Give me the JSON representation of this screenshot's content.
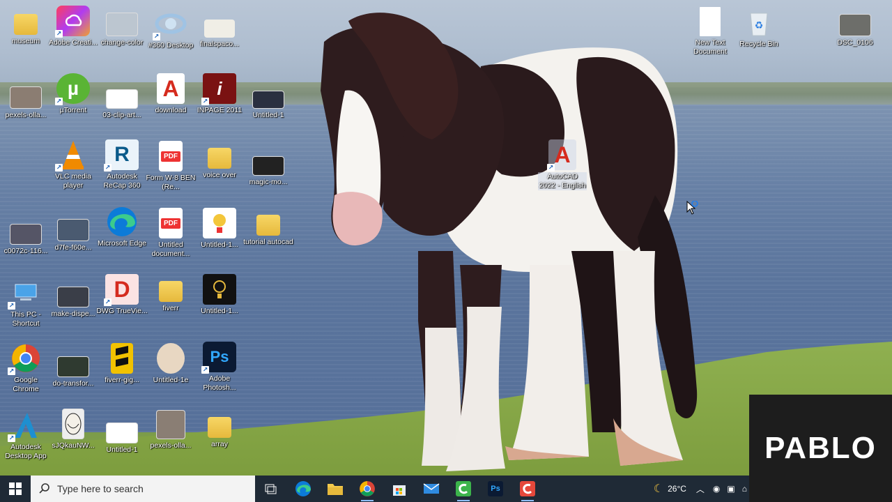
{
  "desktop": {
    "icons": [
      {
        "label": "museum"
      },
      {
        "label": "Adobe Creati..."
      },
      {
        "label": "change-color"
      },
      {
        "label": "#360 Desktop"
      },
      {
        "label": "finalspaco..."
      },
      {
        "label": "pexels-olla..."
      },
      {
        "label": "µTorrent"
      },
      {
        "label": "03-clip-art..."
      },
      {
        "label": "download"
      },
      {
        "label": "INPAGE 2011"
      },
      {
        "label": "Untitled-1"
      },
      {
        "label": "VLC media player"
      },
      {
        "label": "Autodesk ReCap 360"
      },
      {
        "label": "Form W-8 BEN (Re..."
      },
      {
        "label": "voice over"
      },
      {
        "label": "magic-mo..."
      },
      {
        "label": "AutoCAD 2022 - English"
      },
      {
        "label": "c0072c-116..."
      },
      {
        "label": "d7fe-f60e..."
      },
      {
        "label": "Microsoft Edge"
      },
      {
        "label": "Untitled document..."
      },
      {
        "label": "Untitled-1..."
      },
      {
        "label": "tutorial autocad"
      },
      {
        "label": "This PC - Shortcut"
      },
      {
        "label": "make-dispe..."
      },
      {
        "label": "DWG TrueVie..."
      },
      {
        "label": "fiverr"
      },
      {
        "label": "Untitled-1..."
      },
      {
        "label": "Google Chrome"
      },
      {
        "label": "do-transfor..."
      },
      {
        "label": "fiverr-gig..."
      },
      {
        "label": "Untitled-1e"
      },
      {
        "label": "Adobe Photosh..."
      },
      {
        "label": "Autodesk Desktop App"
      },
      {
        "label": "sJQkauNW..."
      },
      {
        "label": "Untitled-1"
      },
      {
        "label": "pexels-olla..."
      },
      {
        "label": "array"
      },
      {
        "label": "New Text Document"
      },
      {
        "label": "Recycle Bin"
      },
      {
        "label": "DSC_0106"
      }
    ],
    "icon_glyphs": {
      "tile_a": "A",
      "tile_r": "R",
      "tile_d": "D",
      "tile_ps": "Ps",
      "tile_pdf": "PDF",
      "tile_utorrent": "µ",
      "tile_inpage": "i"
    }
  },
  "taskbar": {
    "search_placeholder": "Type here to search",
    "temperature": "26°C",
    "apps": [
      {
        "name": "task-view"
      },
      {
        "name": "microsoft-edge"
      },
      {
        "name": "file-explorer"
      },
      {
        "name": "google-chrome"
      },
      {
        "name": "microsoft-store"
      },
      {
        "name": "mail"
      },
      {
        "name": "camtasia-green"
      },
      {
        "name": "photoshop"
      },
      {
        "name": "camtasia-red"
      }
    ],
    "photoshop_label": "Ps"
  },
  "overlay": {
    "watermark": "PABLO"
  },
  "colors": {
    "taskbar_bg": "#1f2a36",
    "search_bg": "#f3f3f3",
    "watermark_bg": "#1d1d1d"
  }
}
